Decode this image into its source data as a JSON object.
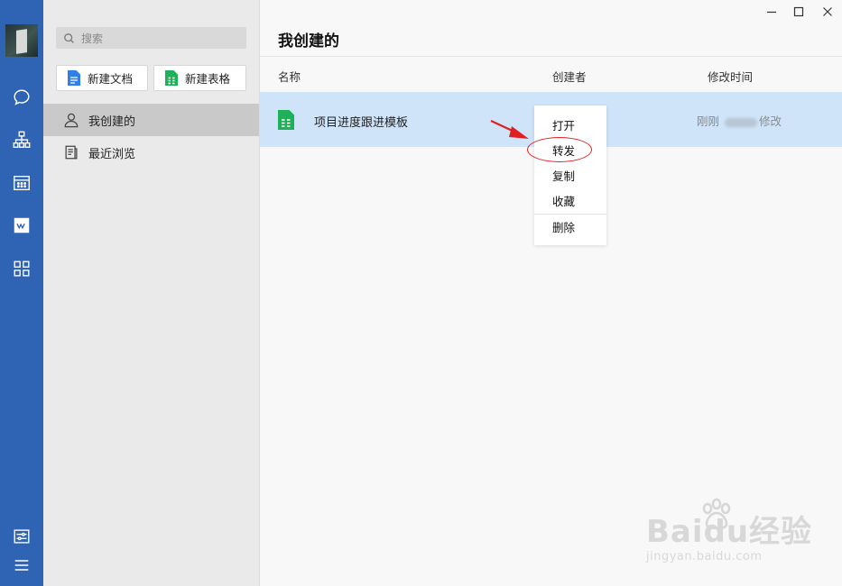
{
  "rail": {
    "icons": [
      "chat-icon",
      "org-icon",
      "calendar-icon",
      "doc-app-icon",
      "apps-icon",
      "settings-icon",
      "menu-icon"
    ],
    "accent": "#2f63b3"
  },
  "panel": {
    "search_placeholder": "搜索",
    "new_doc_label": "新建文档",
    "new_sheet_label": "新建表格",
    "nav": [
      {
        "label": "我创建的",
        "active": true
      },
      {
        "label": "最近浏览",
        "active": false
      }
    ]
  },
  "main": {
    "title": "我创建的",
    "columns": {
      "name": "名称",
      "creator": "创建者",
      "modified": "修改时间"
    },
    "files": [
      {
        "name": "项目进度跟进模板",
        "modified_prefix": "刚刚",
        "modified_suffix": "修改",
        "selected": true
      }
    ],
    "selection_color": "#cfe4f8"
  },
  "context_menu": {
    "items": [
      "打开",
      "转发",
      "复制",
      "收藏",
      "删除"
    ],
    "highlighted": "转发",
    "highlight_color": "#e02020"
  },
  "watermark": {
    "brand": "Baidu经验",
    "url": "jingyan.baidu.com"
  }
}
